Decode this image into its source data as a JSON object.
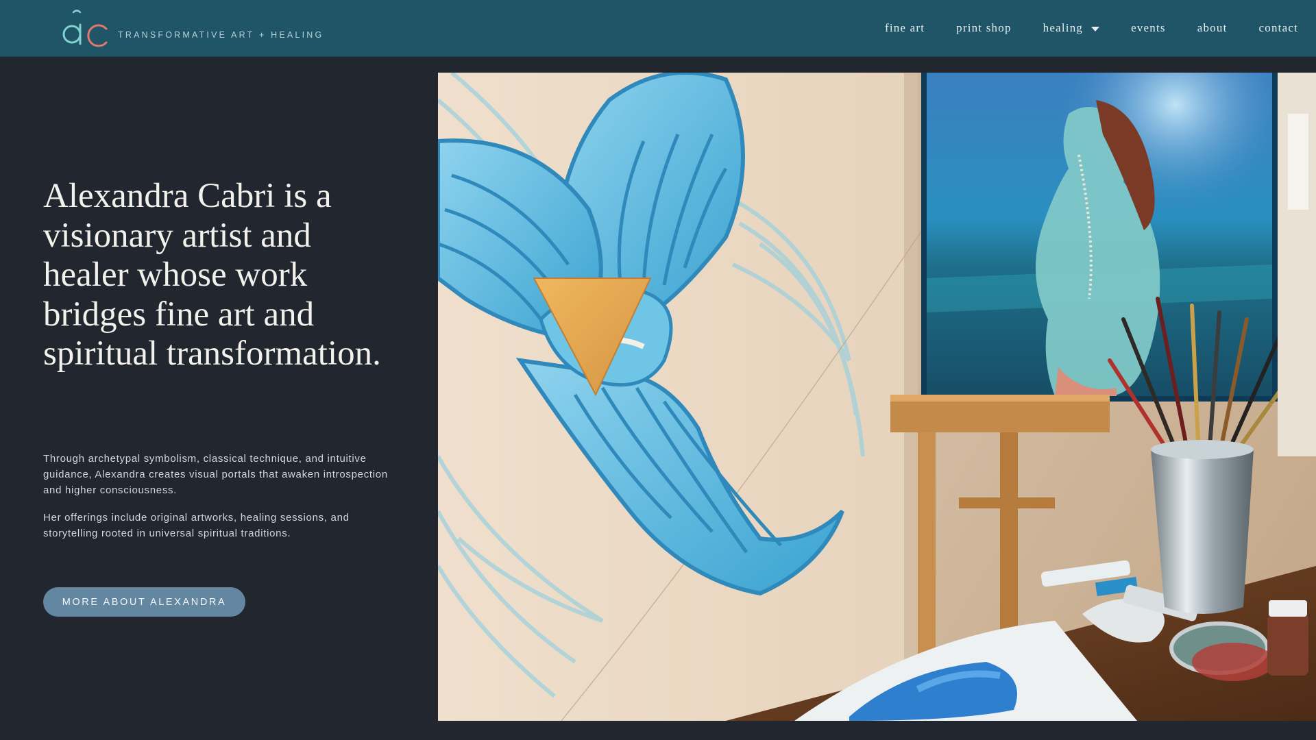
{
  "header": {
    "tagline": "TRANSFORMATIVE ART + HEALING",
    "logo_icon": "ac-monogram-logo",
    "nav": [
      {
        "label": "fine art"
      },
      {
        "label": "print shop"
      },
      {
        "label": "healing",
        "icon": "caret-down-icon"
      },
      {
        "label": "events"
      },
      {
        "label": "about"
      },
      {
        "label": "contact"
      }
    ]
  },
  "hero": {
    "headline": "Alexandra Cabri is a visionary artist and healer whose work bridges fine art and spiritual transformation.",
    "paragraphs": [
      "Through archetypal symbolism, classical technique, and intuitive guidance, Alexandra creates visual portals that awaken introspection and higher consciousness.",
      "Her offerings include original artworks, healing sessions, and storytelling rooted in universal spiritual traditions."
    ],
    "cta_label": "MORE ABOUT ALEXANDRA",
    "image": "artist-studio-painting-image"
  },
  "colors": {
    "header_bg": "#205568",
    "page_bg": "#22262f",
    "button_bg": "#6386a1",
    "logo_teal": "#7fd2d0",
    "logo_coral": "#e0786f"
  }
}
